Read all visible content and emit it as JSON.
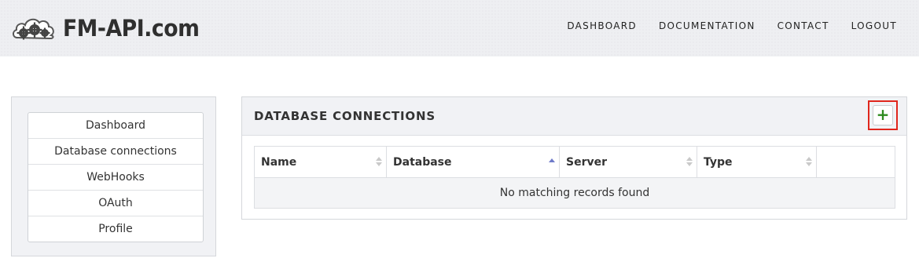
{
  "brand": {
    "name": "FM-API.com",
    "logo_icon": "cloud-gears-icon"
  },
  "nav": {
    "items": [
      "DASHBOARD",
      "DOCUMENTATION",
      "CONTACT",
      "LOGOUT"
    ]
  },
  "sidebar": {
    "items": [
      "Dashboard",
      "Database connections",
      "WebHooks",
      "OAuth",
      "Profile"
    ]
  },
  "panel": {
    "title": "DATABASE CONNECTIONS",
    "add_button": {
      "label": "+",
      "icon": "plus-icon",
      "color": "#2e8b1f",
      "highlight": "#e0261c"
    },
    "table": {
      "columns": [
        {
          "label": "Name",
          "sort": "none"
        },
        {
          "label": "Database",
          "sort": "asc"
        },
        {
          "label": "Server",
          "sort": "none"
        },
        {
          "label": "Type",
          "sort": "none"
        },
        {
          "label": "",
          "sort": "unsortable"
        }
      ],
      "empty_message": "No matching records found"
    }
  }
}
